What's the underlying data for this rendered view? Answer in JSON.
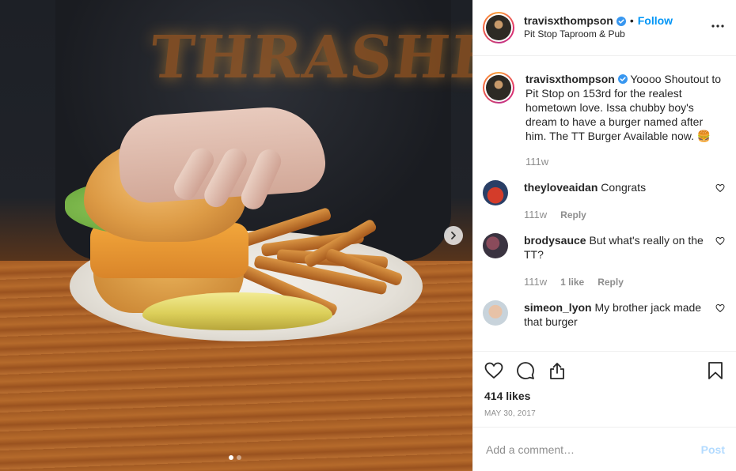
{
  "header": {
    "username": "travisxthompson",
    "separator": "•",
    "follow_label": "Follow",
    "location": "Pit Stop Taproom & Pub",
    "more_icon": "more-options-icon"
  },
  "photo": {
    "hoodie_text": "THRASHER",
    "next_icon": "chevron-right-icon",
    "dots": 2,
    "active_dot": 1
  },
  "caption": {
    "username": "travisxthompson",
    "text": "Yoooo Shoutout to Pit Stop on 153rd for the realest hometown love. Issa chubby boy's dream to have a burger named after him. The TT Burger Available now. 🍔",
    "age": "111w"
  },
  "comments": [
    {
      "username": "theyloveaidan",
      "text": "Congrats",
      "age": "111w",
      "likes": "",
      "reply": "Reply"
    },
    {
      "username": "brodysauce",
      "text": "But what's really on the TT?",
      "age": "111w",
      "likes": "1 like",
      "reply": "Reply"
    },
    {
      "username": "simeon_lyon",
      "text": "My brother jack made that burger"
    }
  ],
  "actions": {
    "likes": "414 likes",
    "date": "MAY 30, 2017"
  },
  "add_comment": {
    "placeholder": "Add a comment…",
    "post_label": "Post"
  },
  "colors": {
    "accent": "#0095f6",
    "text": "#262626",
    "muted": "#8e8e8e",
    "border": "#efefef",
    "post_disabled": "#b3dbff"
  }
}
